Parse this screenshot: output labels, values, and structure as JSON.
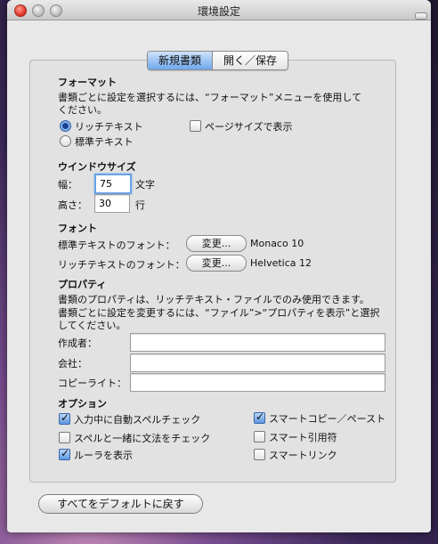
{
  "window": {
    "title": "環境設定"
  },
  "tabs": [
    "新規書類",
    "開く／保存"
  ],
  "format": {
    "heading": "フォーマット",
    "desc1": "書類ごとに設定を選択するには、“フォーマット”メニューを使用して",
    "desc2": "ください。",
    "rich_text": "リッチテキスト",
    "plain_text": "標準テキスト",
    "page_size": "ページサイズで表示",
    "selected": "リッチテキスト",
    "page_size_checked": false
  },
  "window_size": {
    "heading": "ウインドウサイズ",
    "width_label": "幅：",
    "width_value": "75",
    "width_unit": "文字",
    "height_label": "高さ：",
    "height_value": "30",
    "height_unit": "行"
  },
  "font": {
    "heading": "フォント",
    "plain_label": "標準テキストのフォント：",
    "plain_button": "変更...",
    "plain_value": "Monaco 10",
    "rich_label": "リッチテキストのフォント：",
    "rich_button": "変更...",
    "rich_value": "Helvetica 12"
  },
  "properties": {
    "heading": "プロパティ",
    "desc1": "書類のプロパティは、リッチテキスト・ファイルでのみ使用できます。",
    "desc2": "書類ごとに設定を変更するには、“ファイル”>“プロパティを表示”と選択",
    "desc3": "してください。",
    "author_label": "作成者：",
    "company_label": "会社：",
    "copyright_label": "コピーライト：",
    "author_value": "",
    "company_value": "",
    "copyright_value": ""
  },
  "options": {
    "heading": "オプション",
    "spell": {
      "label": "入力中に自動スペルチェック",
      "checked": true
    },
    "grammar": {
      "label": "スペルと一緒に文法をチェック",
      "checked": false
    },
    "ruler": {
      "label": "ルーラを表示",
      "checked": true
    },
    "smart_copy": {
      "label": "スマートコピー／ペースト",
      "checked": true
    },
    "smart_quotes": {
      "label": "スマート引用符",
      "checked": false
    },
    "smart_links": {
      "label": "スマートリンク",
      "checked": false
    }
  },
  "restore_button": "すべてをデフォルトに戻す"
}
